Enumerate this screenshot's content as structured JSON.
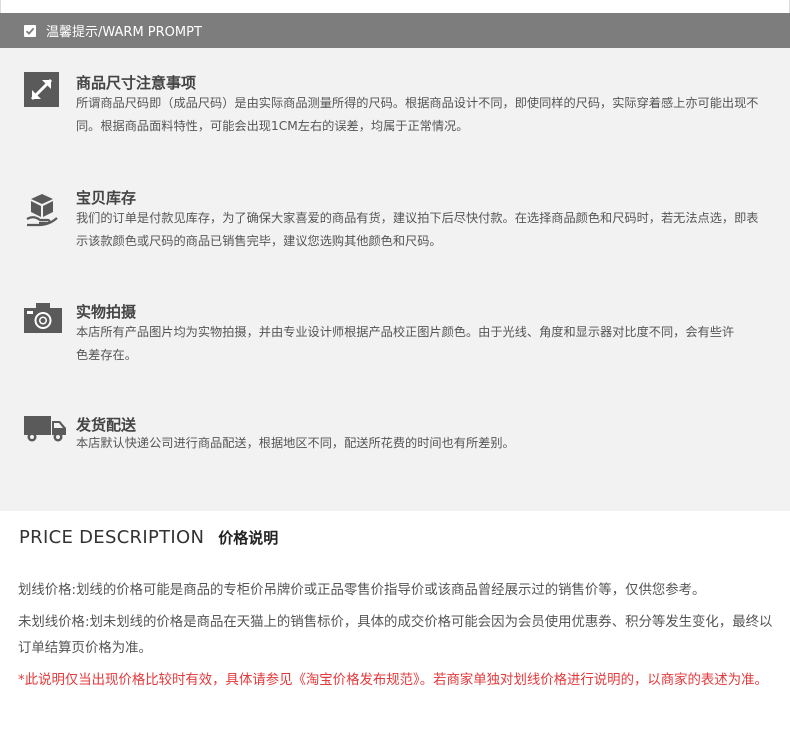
{
  "header": {
    "title": "温馨提示/WARM PROMPT",
    "icon": "check-icon"
  },
  "notices": [
    {
      "icon": "resize-arrow-icon",
      "title": "商品尺寸注意事项",
      "text": "所谓商品尺码即（成品尺码）是由实际商品测量所得的尺码。根据商品设计不同，即使同样的尺码，实际穿着感上亦可能出现不同。根据商品面料特性，可能会出现1CM左右的误差，均属于正常情况。"
    },
    {
      "icon": "stock-box-hand-icon",
      "title": "宝贝库存",
      "text": "我们的订单是付款见库存，为了确保大家喜爱的商品有货，建议拍下后尽快付款。在选择商品颜色和尺码时，若无法点选，即表示该款颜色或尺码的商品已销售完毕，建议您选购其他颜色和尺码。"
    },
    {
      "icon": "camera-icon",
      "title": "实物拍摄",
      "text": "本店所有产品图片均为实物拍摄，并由专业设计师根据产品校正图片颜色。由于光线、角度和显示器对比度不同，会有些许色差存在。"
    },
    {
      "icon": "delivery-truck-icon",
      "title": "发货配送",
      "text": "本店默认快递公司进行商品配送，根据地区不同，配送所花费的时间也有所差别。"
    }
  ],
  "price": {
    "heading_en": "PRICE DESCRIPTION",
    "heading_cn": "价格说明",
    "paragraphs": [
      "划线价格:划线的价格可能是商品的专柜价吊牌价或正品零售价指导价或该商品曾经展示过的销售价等，仅供您参考。",
      "未划线价格:划未划线的价格是商品在天猫上的销售标价，具体的成交价格可能会因为会员使用优惠券、积分等发生变化，最终以订单结算页价格为准。",
      "*此说明仅当出现价格比较时有效，具体请参见《淘宝价格发布规范》。若商家单独对划线价格进行说明的，以商家的表述为准。"
    ]
  },
  "colors": {
    "header_bg": "#7d7d7d",
    "panel_bg": "#f2f2f2",
    "icon_gray": "#5a5a5a",
    "warning_red": "#e4393c"
  }
}
